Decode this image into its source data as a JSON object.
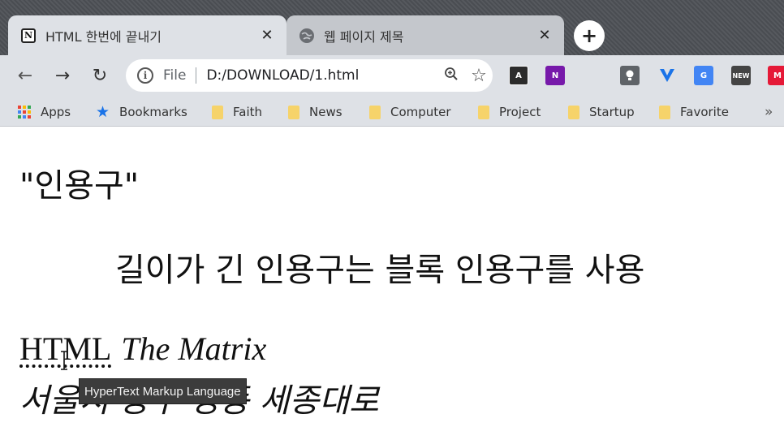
{
  "tabs": [
    {
      "title": "HTML 한번에 끝내기",
      "active": true,
      "favicon": "notion-icon",
      "close": "✕"
    },
    {
      "title": "웹 페이지 제목",
      "active": false,
      "favicon": "globe-icon",
      "close": "✕"
    }
  ],
  "new_tab_symbol": "+",
  "toolbar": {
    "back": "←",
    "forward": "→",
    "reload": "↻",
    "scheme": "File",
    "url": "D:/DOWNLOAD/1.html",
    "zoom_icon": "🔍︎",
    "bookmark_star": "☆"
  },
  "extensions": [
    {
      "name": "font-a-ext-icon",
      "label": "A",
      "color": "#2b2b2b"
    },
    {
      "name": "onenote-ext-icon",
      "label": "N",
      "color": "#7719aa"
    },
    {
      "name": "keep-ext-icon",
      "label": "💡",
      "color": "#5f6368"
    },
    {
      "name": "v-ext-icon",
      "label": "V",
      "color": "#1a73e8"
    },
    {
      "name": "translate-ext-icon",
      "label": "G",
      "color": "#4285f4"
    },
    {
      "name": "new-ext-icon",
      "label": "NEW",
      "color": "#444444"
    },
    {
      "name": "meetup-ext-icon",
      "label": "M",
      "color": "#e51937"
    }
  ],
  "bookmarks": [
    {
      "label": "Apps",
      "icon": "apps-icon"
    },
    {
      "label": "Bookmarks",
      "icon": "star-icon"
    },
    {
      "label": "Faith",
      "icon": "folder-icon"
    },
    {
      "label": "News",
      "icon": "folder-icon"
    },
    {
      "label": "Computer",
      "icon": "folder-icon"
    },
    {
      "label": "Project",
      "icon": "folder-icon"
    },
    {
      "label": "Startup",
      "icon": "folder-icon"
    },
    {
      "label": "Favorite",
      "icon": "folder-icon"
    }
  ],
  "bookmarks_overflow": "»",
  "page": {
    "inline_quote": "\"인용구\"",
    "blockquote": "길이가 긴 인용구는 블록 인용구를 사용",
    "abbr": "HTML",
    "cite": "The Matrix",
    "address": "서울시 중구 명동 세종대로",
    "tooltip": "HyperText Markup Language"
  }
}
